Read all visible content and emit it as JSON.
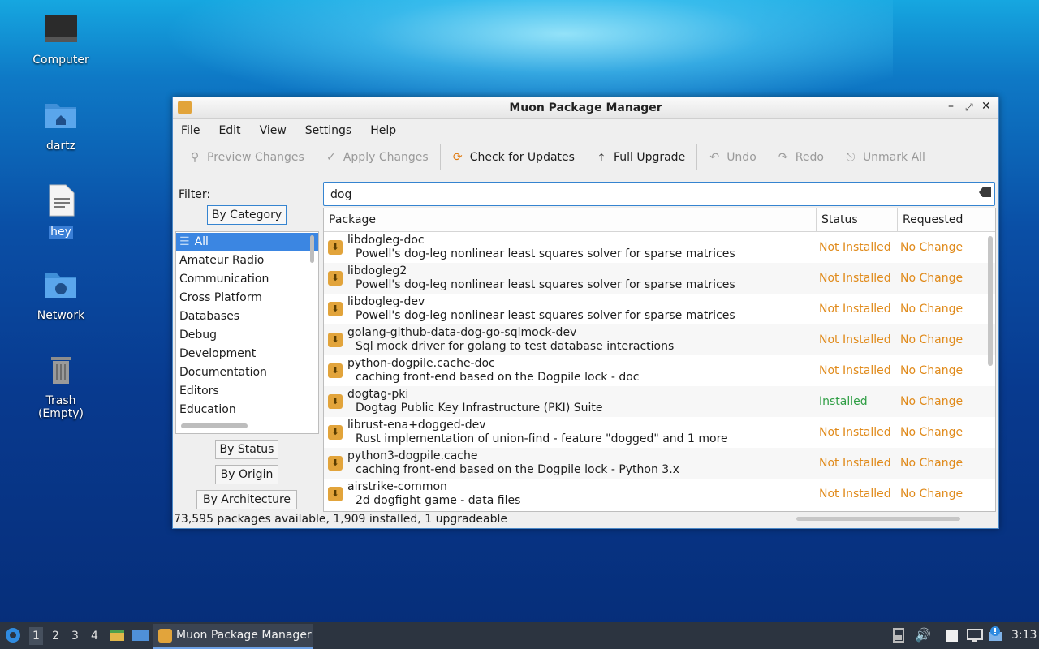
{
  "desktop": {
    "icons": [
      {
        "label": "Computer"
      },
      {
        "label": "dartz"
      },
      {
        "label": "hey"
      },
      {
        "label": "Network"
      },
      {
        "label": "Trash (Empty)"
      }
    ]
  },
  "window": {
    "title": "Muon Package Manager",
    "menu": [
      "File",
      "Edit",
      "View",
      "Settings",
      "Help"
    ],
    "toolbar": {
      "preview": "Preview Changes",
      "apply": "Apply Changes",
      "check": "Check for Updates",
      "upgrade": "Full Upgrade",
      "undo": "Undo",
      "redo": "Redo",
      "unmark": "Unmark All"
    },
    "filter_label": "Filter:",
    "filter_tabs": {
      "category": "By Category",
      "status": "By Status",
      "origin": "By Origin",
      "architecture": "By Architecture"
    },
    "categories": [
      "All",
      "Amateur Radio",
      "Communication",
      "Cross Platform",
      "Databases",
      "Debug",
      "Development",
      "Documentation",
      "Editors",
      "Education"
    ],
    "search_value": "dog",
    "columns": {
      "package": "Package",
      "status": "Status",
      "requested": "Requested"
    },
    "packages": [
      {
        "name": "libdogleg-doc",
        "desc": "Powell's dog-leg nonlinear least squares solver for sparse matrices",
        "status": "Not Installed",
        "requested": "No Change"
      },
      {
        "name": "libdogleg2",
        "desc": "Powell's dog-leg nonlinear least squares solver for sparse matrices",
        "status": "Not Installed",
        "requested": "No Change"
      },
      {
        "name": "libdogleg-dev",
        "desc": "Powell's dog-leg nonlinear least squares solver for sparse matrices",
        "status": "Not Installed",
        "requested": "No Change"
      },
      {
        "name": "golang-github-data-dog-go-sqlmock-dev",
        "desc": "Sql mock driver for golang to test database interactions",
        "status": "Not Installed",
        "requested": "No Change"
      },
      {
        "name": "python-dogpile.cache-doc",
        "desc": "caching front-end based on the Dogpile lock - doc",
        "status": "Not Installed",
        "requested": "No Change"
      },
      {
        "name": "dogtag-pki",
        "desc": "Dogtag Public Key Infrastructure (PKI) Suite",
        "status": "Installed",
        "requested": "No Change"
      },
      {
        "name": "librust-ena+dogged-dev",
        "desc": "Rust implementation of union-find - feature \"dogged\" and 1 more",
        "status": "Not Installed",
        "requested": "No Change"
      },
      {
        "name": "python3-dogpile.cache",
        "desc": "caching front-end based on the Dogpile lock - Python 3.x",
        "status": "Not Installed",
        "requested": "No Change"
      },
      {
        "name": "airstrike-common",
        "desc": "2d dogfight game - data files",
        "status": "Not Installed",
        "requested": "No Change"
      }
    ],
    "statusbar": "73,595 packages available, 1,909 installed, 1 upgradeable"
  },
  "taskbar": {
    "workspaces": [
      "1",
      "2",
      "3",
      "4"
    ],
    "task_title": "Muon Package Manager",
    "clock": "3:13"
  }
}
